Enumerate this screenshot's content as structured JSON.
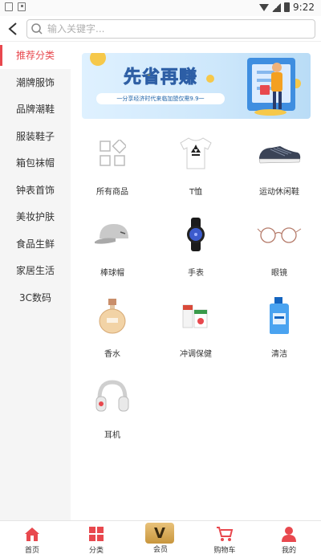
{
  "status_bar": {
    "time": "9:22"
  },
  "search": {
    "placeholder": "输入关键字..."
  },
  "sidebar": {
    "items": [
      {
        "label": "推荐分类",
        "active": true
      },
      {
        "label": "潮牌服饰"
      },
      {
        "label": "品牌潮鞋"
      },
      {
        "label": "服装鞋子"
      },
      {
        "label": "箱包袜帽"
      },
      {
        "label": "钟表首饰"
      },
      {
        "label": "美妆护肤"
      },
      {
        "label": "食品生鲜"
      },
      {
        "label": "家居生活"
      },
      {
        "label": "3C数码"
      }
    ]
  },
  "banner": {
    "title": "先省再赚",
    "subtitle": "一分享经济时代来临加盟仅需9.9一"
  },
  "categories": [
    {
      "label": "所有商品",
      "icon": "all-products-icon"
    },
    {
      "label": "T恤",
      "icon": "tshirt-icon"
    },
    {
      "label": "运动休闲鞋",
      "icon": "sneaker-icon"
    },
    {
      "label": "棒球帽",
      "icon": "baseball-cap-icon"
    },
    {
      "label": "手表",
      "icon": "watch-icon"
    },
    {
      "label": "眼镜",
      "icon": "glasses-icon"
    },
    {
      "label": "香水",
      "icon": "perfume-icon"
    },
    {
      "label": "冲调保健",
      "icon": "health-drink-icon"
    },
    {
      "label": "清洁",
      "icon": "detergent-icon"
    },
    {
      "label": "耳机",
      "icon": "headphones-icon"
    }
  ],
  "bottom_nav": {
    "items": [
      {
        "label": "首页",
        "icon": "home-icon"
      },
      {
        "label": "分类",
        "icon": "category-icon"
      },
      {
        "label": "会员",
        "icon": "vip-icon",
        "badge": "V"
      },
      {
        "label": "购物车",
        "icon": "cart-icon"
      },
      {
        "label": "我的",
        "icon": "profile-icon"
      }
    ]
  },
  "colors": {
    "accent": "#e8484e",
    "vip_gold": "#d4a24c"
  }
}
